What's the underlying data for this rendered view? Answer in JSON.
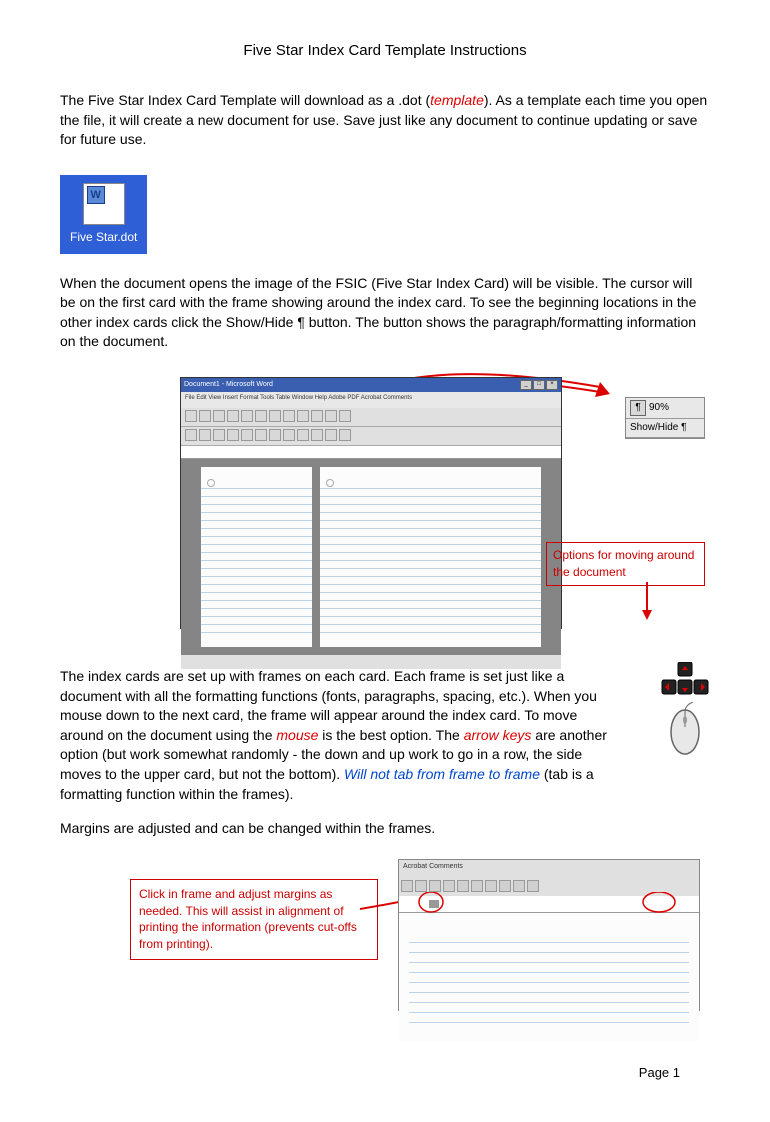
{
  "title": "Five Star Index Card Template Instructions",
  "para1_pre": "The Five Star Index Card Template will download as a .dot (",
  "para1_emph": "template",
  "para1_post": ").  As a template each time you open the file, it will create a new document for use. Save just like any document to continue updating or save for future use.",
  "file_icon_label": "Five Star.dot",
  "para2": "When the document opens the image of the FSIC (Five Star Index Card) will be visible.  The cursor will be on the first card with the frame showing around the index card.  To see the beginning locations in the other index cards click the Show/Hide ¶ button.  The button shows the paragraph/formatting information on the document.",
  "word_title": "Document1 - Microsoft Word",
  "word_menu": "File  Edit  View  Insert  Format  Tools  Table  Window  Help  Adobe PDF  Acrobat Comments",
  "callout_zoom": "90%",
  "callout_showhide": "Show/Hide ¶",
  "options_text": "Options for moving around the document",
  "para3_1": "The index cards are set up with frames on each card.  Each frame is set just like a document with all the formatting functions (fonts, paragraphs, spacing, etc.).  When you mouse down to the next card, the frame will appear around the index card.  To move around on the document using the ",
  "para3_mouse": "mouse",
  "para3_2": " is the best option.  The ",
  "para3_arrow": "arrow keys",
  "para3_3": " are another option (but work somewhat randomly - the down and up work to go in a row, the side moves to the upper card, but not the bottom). ",
  "para3_tab": "Will not tab from frame to frame",
  "para3_4": " (tab is a formatting function within the frames).",
  "para4": "Margins are adjusted and can be changed within the frames.",
  "margins_callout": "Click in frame and adjust margins as needed.  This will assist in alignment of printing the information (prevents cut-offs from printing).",
  "ruler_toolbar_label": "Acrobat Comments",
  "page_num": "Page 1"
}
